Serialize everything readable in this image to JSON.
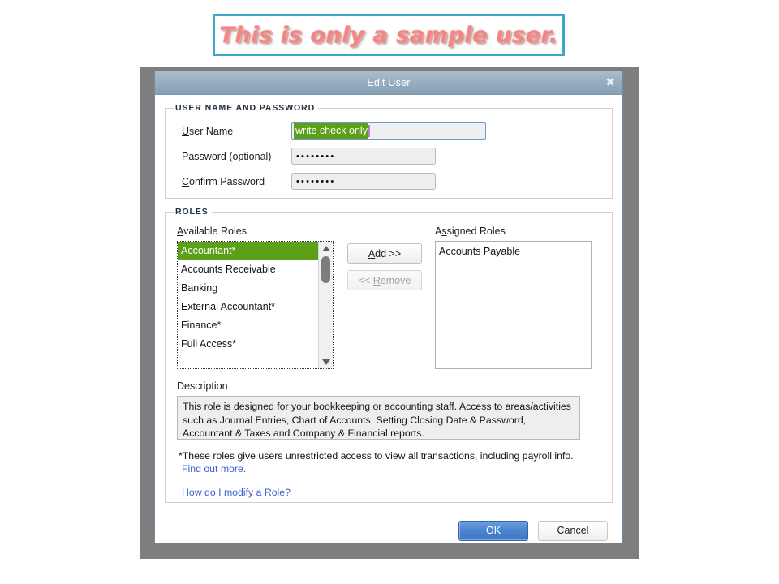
{
  "banner": {
    "text": "This is only a sample user.",
    "border_color": "#3ba9c4",
    "text_color": "#ea6c6a"
  },
  "dialog": {
    "title": "Edit User",
    "close_icon": "close-icon",
    "close_glyph": "✖"
  },
  "credentials": {
    "legend": "USER NAME AND PASSWORD",
    "fields": [
      {
        "label_prefix": "U",
        "label_rest": "ser Name",
        "value": "write check only",
        "selected": true
      },
      {
        "label_prefix": "P",
        "label_rest": "assword (optional)",
        "value": "••••••••",
        "selected": false
      },
      {
        "label_prefix": "C",
        "label_rest": "onfirm Password",
        "value": "••••••••",
        "selected": false
      }
    ],
    "username_value": "write check only",
    "password_value": "••••••••",
    "confirm_value": "••••••••"
  },
  "roles": {
    "legend": "ROLES",
    "available_label_prefix": "A",
    "available_label_rest": "vailable Roles",
    "assigned_label_prefix": "A",
    "assigned_label_mid": "s",
    "assigned_label_rest": "signed Roles",
    "available": [
      {
        "label": "Accountant*",
        "selected": true
      },
      {
        "label": "Accounts Receivable",
        "selected": false
      },
      {
        "label": "Banking",
        "selected": false
      },
      {
        "label": "External Accountant*",
        "selected": false
      },
      {
        "label": "Finance*",
        "selected": false
      },
      {
        "label": "Full Access*",
        "selected": false
      }
    ],
    "assigned": [
      {
        "label": "Accounts Payable",
        "selected": false
      }
    ],
    "add_button": {
      "pre": "",
      "accel": "A",
      "post": "dd >>",
      "enabled": true
    },
    "remove_button": {
      "pre": "<< ",
      "accel": "R",
      "post": "emove",
      "enabled": false
    },
    "selected_color": "#5ba018"
  },
  "description": {
    "label": "Description",
    "text": "This role is designed for your bookkeeping or accounting staff. Access to areas/activities such as Journal Entries, Chart of Accounts, Setting Closing Date & Password, Accountant & Taxes and Company & Financial reports."
  },
  "footnote": {
    "text": "*These roles give users unrestricted access to view all transactions, including payroll info.",
    "find_out_more": "Find out more.",
    "modify_role": "How do I modify a Role?",
    "link_color": "#3b5fd0"
  },
  "footer": {
    "ok_label": "OK",
    "cancel_label": "Cancel",
    "ok_color": "#4a83cf"
  }
}
